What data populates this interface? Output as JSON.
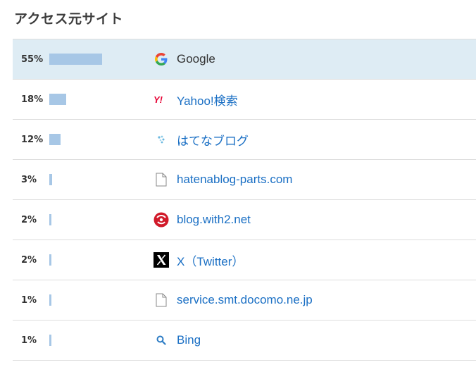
{
  "title": "アクセス元サイト",
  "rows": [
    {
      "percent": "55%",
      "fraction": 0.55,
      "name": "Google",
      "icon": "google-icon",
      "link": false
    },
    {
      "percent": "18%",
      "fraction": 0.18,
      "name": "Yahoo!検索",
      "icon": "yahoo-icon",
      "link": true
    },
    {
      "percent": "12%",
      "fraction": 0.12,
      "name": "はてなブログ",
      "icon": "hatena-blog-icon",
      "link": true
    },
    {
      "percent": "3%",
      "fraction": 0.03,
      "name": "hatenablog-parts.com",
      "icon": "document-icon",
      "link": true
    },
    {
      "percent": "2%",
      "fraction": 0.02,
      "name": "blog.with2.net",
      "icon": "blogranking-icon",
      "link": true
    },
    {
      "percent": "2%",
      "fraction": 0.02,
      "name": "X（Twitter）",
      "icon": "x-icon",
      "link": true
    },
    {
      "percent": "1%",
      "fraction": 0.01,
      "name": "service.smt.docomo.ne.jp",
      "icon": "document-icon",
      "link": true
    },
    {
      "percent": "1%",
      "fraction": 0.01,
      "name": "Bing",
      "icon": "bing-search-icon",
      "link": true
    }
  ],
  "colors": {
    "bar": "#a7c7e6",
    "highlight": "#deecf4",
    "link": "#1a6fc4"
  }
}
